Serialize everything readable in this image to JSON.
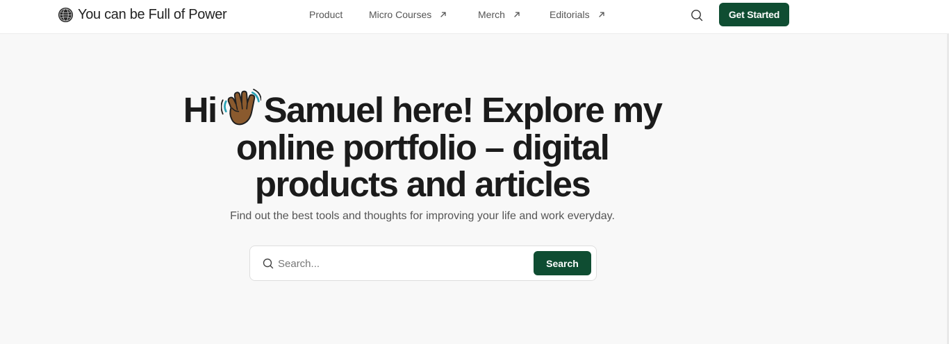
{
  "header": {
    "brand_name": "You can be Full of Power",
    "nav": [
      {
        "label": "Product",
        "external": false
      },
      {
        "label": "Micro Courses",
        "external": true
      },
      {
        "label": "Merch",
        "external": true
      },
      {
        "label": "Editorials",
        "external": true
      }
    ],
    "search_icon": "search-icon",
    "cta_label": "Get Started"
  },
  "hero": {
    "title_prefix": "Hi",
    "title_emoji": "waving-hand-icon",
    "title_line1_rest": "Samuel here! Explore my",
    "title_line2": "online portfolio – digital",
    "title_line3": "products and articles",
    "subtitle": "Find out the best tools and thoughts for improving your life and work everyday."
  },
  "search": {
    "placeholder": "Search...",
    "value": "",
    "button_label": "Search"
  },
  "colors": {
    "accent": "#0f4d32",
    "background": "#f8f8f8",
    "header_bg": "#ffffff",
    "text": "#1b1b1b",
    "muted": "#555555"
  }
}
